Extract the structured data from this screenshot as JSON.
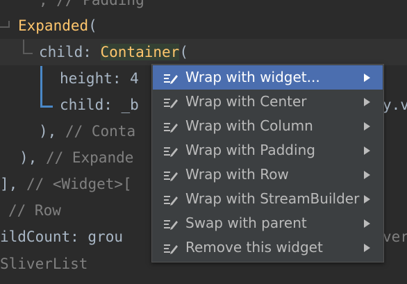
{
  "code": {
    "l0": ", // Padding",
    "l1_kw": "Expanded",
    "l1_p": "(",
    "l2_a": "child: ",
    "l2_b": "Container",
    "l2_c": "(",
    "l3_a": "height: 4",
    "l4_a": "child: _b",
    "l4_b": "y.v",
    "l5_a": "), ",
    "l5_b": "// Conta",
    "l6_a": "), ",
    "l6_b": "// Expande",
    "l7_a": "], ",
    "l7_b": "// <Widget>[",
    "l8_a": "// Row",
    "l9_a": "ildCount: grou",
    "l9_b": "ver",
    "l10_a": "SliverList"
  },
  "menu": {
    "items": [
      {
        "label": "Wrap with widget...",
        "icon": "intention-icon",
        "selected": true
      },
      {
        "label": "Wrap with Center",
        "icon": "intention-icon"
      },
      {
        "label": "Wrap with Column",
        "icon": "intention-icon"
      },
      {
        "label": "Wrap with Padding",
        "icon": "intention-icon"
      },
      {
        "label": "Wrap with Row",
        "icon": "intention-icon"
      },
      {
        "label": "Wrap with StreamBuilder",
        "icon": "intention-icon"
      },
      {
        "label": "Swap with parent",
        "icon": "intention-icon"
      },
      {
        "label": "Remove this widget",
        "icon": "intention-icon"
      }
    ]
  }
}
